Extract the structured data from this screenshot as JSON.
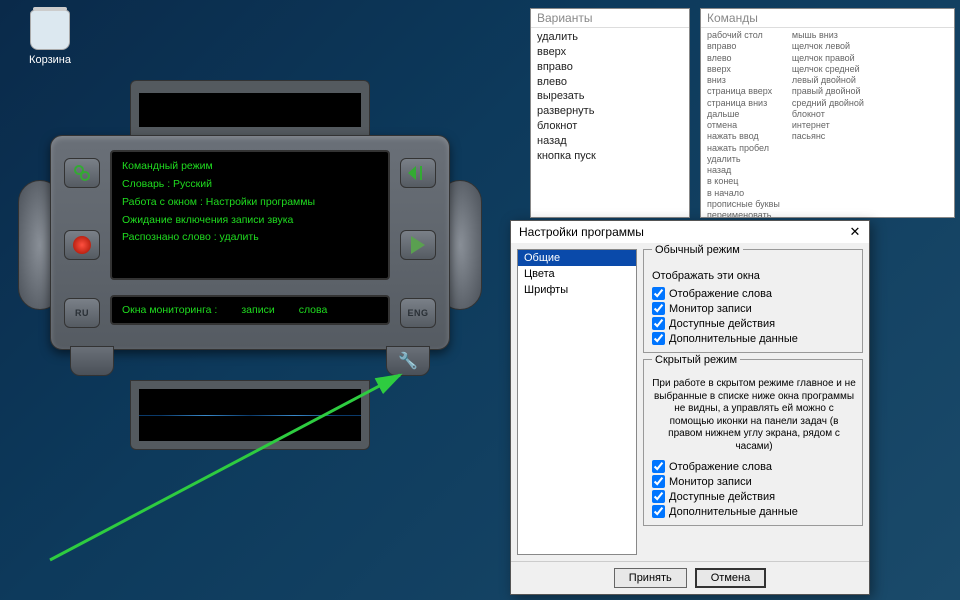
{
  "desktop": {
    "recycle_bin": "Корзина"
  },
  "device": {
    "lines": [
      "Командный режим",
      "Словарь : Русский",
      "Работа с окном : Настройки программы",
      "Ожидание включения записи звука",
      "Распознано слово : удалить"
    ],
    "monitor_label": "Окна мониторинга :",
    "monitor_rec": "записи",
    "monitor_word": "слова",
    "lang_left": "RU",
    "lang_right": "ENG"
  },
  "variants": {
    "title": "Варианты",
    "items": [
      "удалить",
      "вверх",
      "вправо",
      "влево",
      "вырезать",
      "развернуть",
      "блокнот",
      "назад",
      "кнопка пуск"
    ]
  },
  "commands": {
    "title": "Команды",
    "col1": [
      "рабочий стол",
      "вправо",
      "влево",
      "вверх",
      "вниз",
      "страница вверх",
      "страница вниз",
      "дальше",
      "отмена",
      "нажать ввод",
      "нажать пробел",
      "удалить",
      "назад",
      "в конец",
      "в начало",
      "прописные буквы",
      "переименовать"
    ],
    "col2": [
      "мышь вниз",
      "щелчок левой",
      "щелчок правой",
      "щелчок средней",
      "левый двойной",
      "правый двойной",
      "средний двойной",
      "блокнот",
      "интернет",
      "пасьянс"
    ]
  },
  "dialog": {
    "title": "Настройки программы",
    "tabs": [
      "Общие",
      "Цвета",
      "Шрифты"
    ],
    "group_normal": "Обычный режим",
    "group_normal_sub": "Отображать эти окна",
    "checks_normal": [
      "Отображение слова",
      "Монитор записи",
      "Доступные действия",
      "Дополнительные данные"
    ],
    "group_hidden": "Скрытый режим",
    "hidden_desc": "При работе в скрытом режиме главное и не выбранные в списке ниже окна программы не видны, а управлять ей можно с помощью иконки на панели задач (в правом нижнем углу экрана, рядом с часами)",
    "checks_hidden": [
      "Отображение слова",
      "Монитор записи",
      "Доступные действия",
      "Дополнительные данные"
    ],
    "btn_ok": "Принять",
    "btn_cancel": "Отмена"
  }
}
